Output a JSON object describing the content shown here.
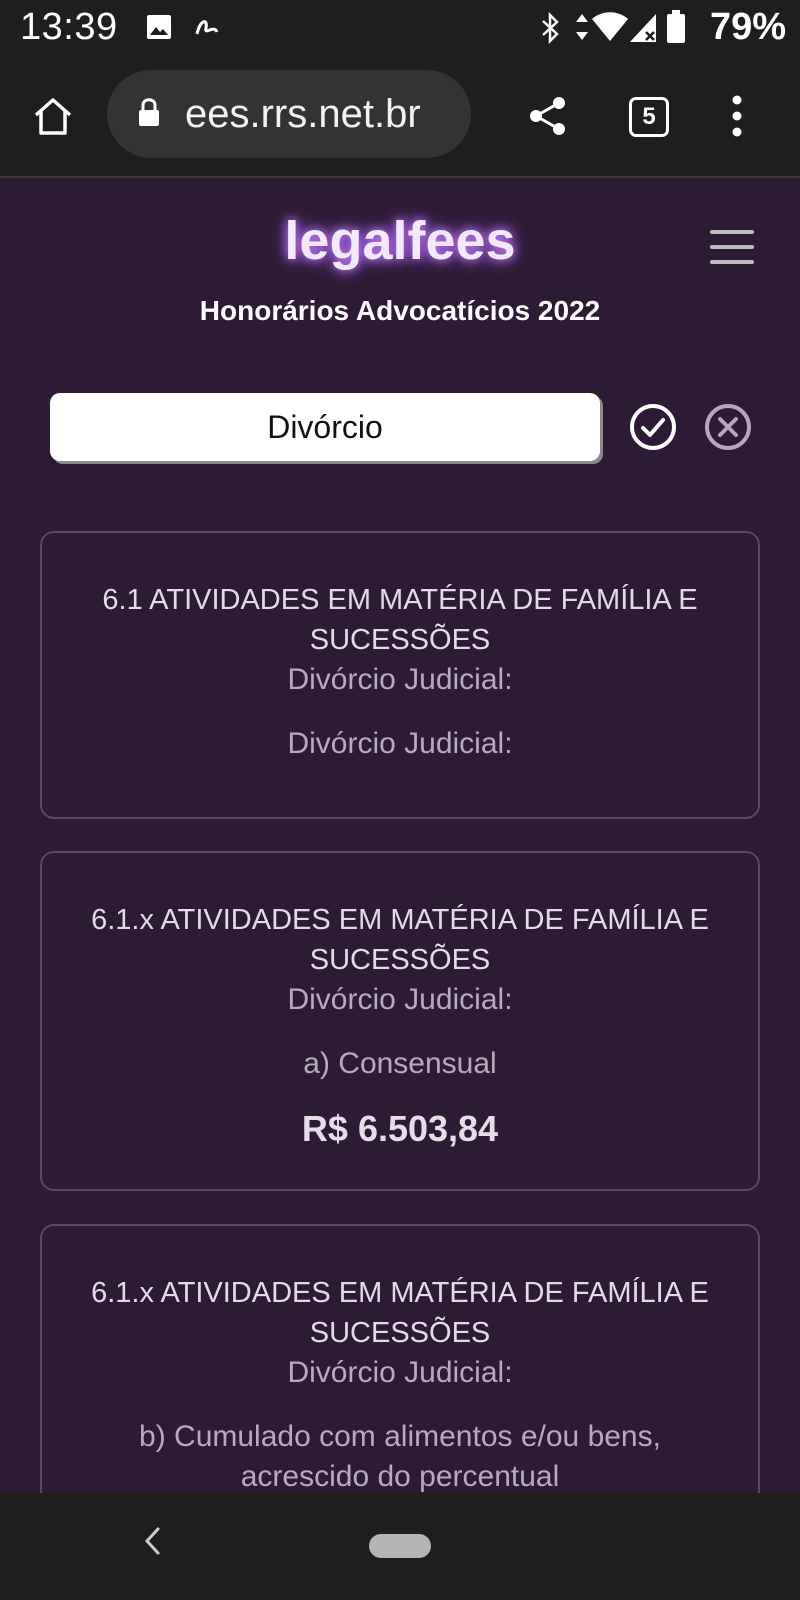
{
  "status_bar": {
    "time": "13:39",
    "battery": "79%",
    "icons": [
      "image-icon",
      "signature-icon",
      "bluetooth-icon",
      "data-arrows-icon",
      "wifi-icon",
      "signal-icon",
      "battery-icon"
    ]
  },
  "browser": {
    "url": "ees.rrs.net.br",
    "tab_count": "5",
    "icons": [
      "home-icon",
      "lock-icon",
      "share-icon",
      "tabs-icon",
      "more-vert-icon"
    ]
  },
  "header": {
    "logo": "legalfees",
    "subtitle": "Honorários Advocatícios 2022"
  },
  "search": {
    "value": "Divórcio"
  },
  "results": [
    {
      "heading": "6.1 ATIVIDADES EM MATÉRIA DE FAMÍLIA E SUCESSÕES",
      "subheading": "Divórcio Judicial:",
      "detail": "Divórcio Judicial:",
      "price": ""
    },
    {
      "heading": "6.1.x ATIVIDADES EM MATÉRIA DE FAMÍLIA E SUCESSÕES",
      "subheading": "Divórcio Judicial:",
      "detail": "a) Consensual",
      "price": "R$ 6.503,84"
    },
    {
      "heading": "6.1.x ATIVIDADES EM MATÉRIA DE FAMÍLIA E SUCESSÕES",
      "subheading": "Divórcio Judicial:",
      "detail": "b) Cumulado com alimentos e/ou bens, acrescido do percentual",
      "price": ""
    }
  ],
  "colors": {
    "page_bg": "#2d1b35",
    "chrome_bg": "#1e1e1e",
    "logo_glow": "#c98bff",
    "card_border": "#584862"
  }
}
